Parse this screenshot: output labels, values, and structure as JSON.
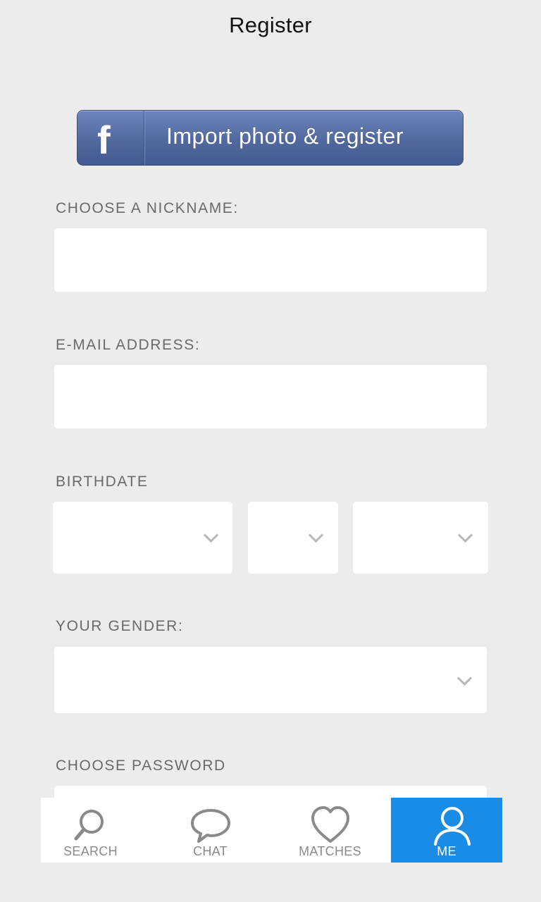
{
  "header": {
    "title": "Register"
  },
  "facebook": {
    "icon": "facebook-f-icon",
    "label": "Import photo & register",
    "color": "#52699e"
  },
  "form": {
    "nickname": {
      "label": "CHOOSE A NICKNAME:",
      "value": ""
    },
    "email": {
      "label": "E-MAIL ADDRESS:",
      "value": ""
    },
    "birthdate": {
      "label": "BIRTHDATE",
      "month": "",
      "day": "",
      "year": ""
    },
    "gender": {
      "label": "YOUR GENDER:",
      "value": ""
    },
    "password": {
      "label": "CHOOSE PASSWORD",
      "value": ""
    }
  },
  "tabbar": {
    "active_color": "#1a8ce6",
    "tabs": [
      {
        "label": "SEARCH",
        "icon": "search-icon"
      },
      {
        "label": "CHAT",
        "icon": "chat-bubble-icon"
      },
      {
        "label": "MATCHES",
        "icon": "heart-icon"
      },
      {
        "label": "ME",
        "icon": "user-icon",
        "active": true
      }
    ]
  }
}
